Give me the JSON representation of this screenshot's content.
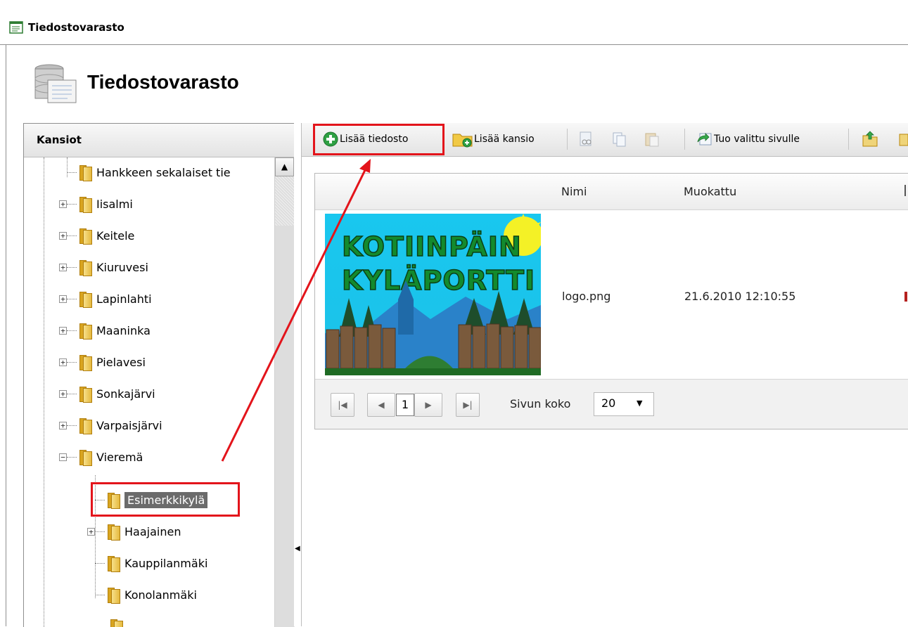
{
  "window": {
    "title": "Tiedostovarasto"
  },
  "header": {
    "title": "Tiedostovarasto"
  },
  "folders": {
    "title": "Kansiot",
    "items": [
      {
        "label": "Hankkeen sekalaiset tie"
      },
      {
        "label": "Iisalmi"
      },
      {
        "label": "Keitele"
      },
      {
        "label": "Kiuruvesi"
      },
      {
        "label": "Lapinlahti"
      },
      {
        "label": "Maaninka"
      },
      {
        "label": "Pielavesi"
      },
      {
        "label": "Sonkajärvi"
      },
      {
        "label": "Varpaisjärvi"
      },
      {
        "label": "Vieremä"
      },
      {
        "label": "Esimerkkikylä"
      },
      {
        "label": "Haajainen"
      },
      {
        "label": "Kauppilanmäki"
      },
      {
        "label": "Konolanmäki"
      }
    ]
  },
  "toolbar": {
    "add_file": "Lisää tiedosto",
    "add_folder": "Lisää kansio",
    "import_selected": "Tuo valittu sivulle"
  },
  "grid": {
    "columns": {
      "name": "Nimi",
      "modified": "Muokattu"
    },
    "rows": [
      {
        "name": "logo.png",
        "modified": "21.6.2010 12:10:55",
        "thumbnail_lines": [
          "KOTIINPÄIN",
          "KYLÄPORTTI"
        ]
      }
    ]
  },
  "pager": {
    "current_page": "1",
    "page_size_label": "Sivun koko",
    "page_size": "20"
  },
  "colors": {
    "highlight": "#e3141b",
    "selected_bg": "#6b6b6b"
  }
}
